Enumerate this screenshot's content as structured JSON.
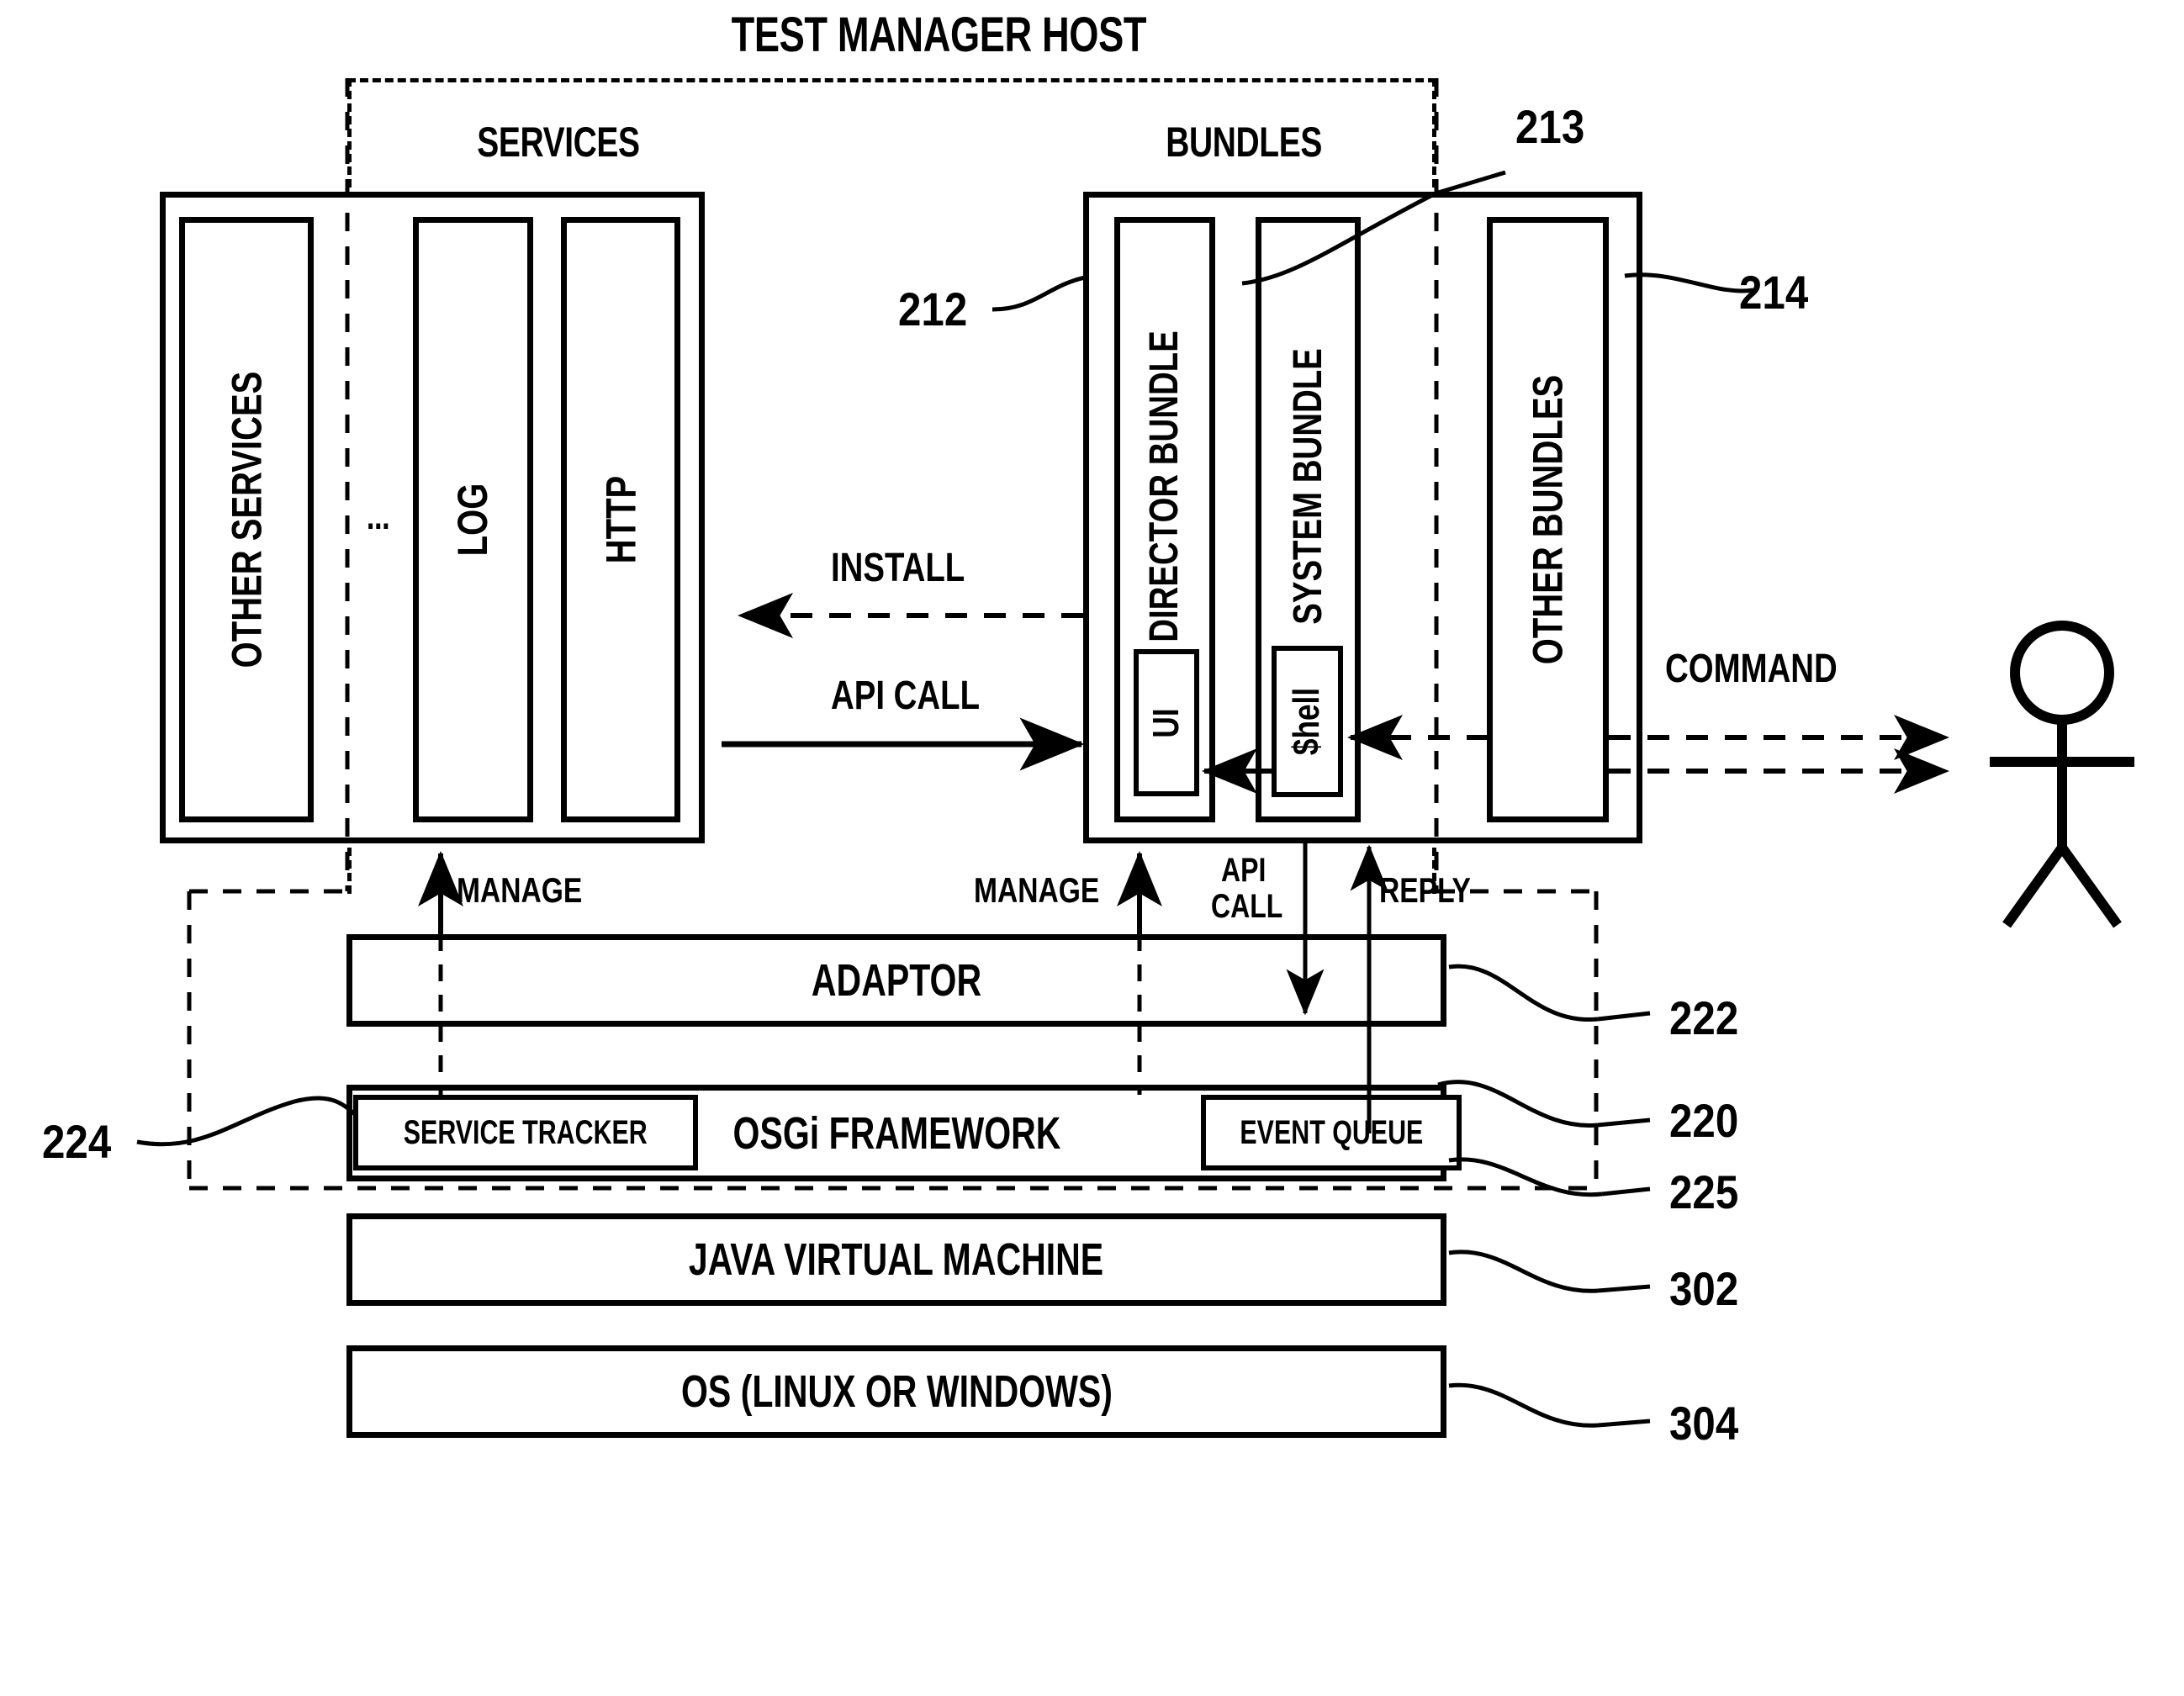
{
  "diagram": {
    "title": "TEST MANAGER HOST",
    "sections": {
      "services_label": "SERVICES",
      "bundles_label": "BUNDLES"
    },
    "services": {
      "other_services": "OTHER SERVICES",
      "ellipsis": "...",
      "log": "LOG",
      "http": "HTTP"
    },
    "bundles": {
      "director_bundle": "DIRECTOR BUNDLE",
      "system_bundle": "SYSTEM BUNDLE",
      "other_bundles": "OTHER BUNDLES",
      "ui": "UI",
      "shell": "$hell"
    },
    "arrows": {
      "install": "INSTALL",
      "api_call": "API CALL",
      "command": "COMMAND",
      "manage_left": "MANAGE",
      "manage_right": "MANAGE",
      "api_call_down_line1": "API",
      "api_call_down_line2": "CALL",
      "reply": "REPLY"
    },
    "layers": {
      "adaptor": "ADAPTOR",
      "service_tracker": "SERVICE TRACKER",
      "osgi_framework": "OSGi FRAMEWORK",
      "event_queue": "EVENT QUEUE",
      "jvm": "JAVA VIRTUAL MACHINE",
      "os": "OS (LINUX OR WINDOWS)"
    },
    "refs": {
      "r212": "212",
      "r213": "213",
      "r214": "214",
      "r220": "220",
      "r222": "222",
      "r224": "224",
      "r225": "225",
      "r302": "302",
      "r304": "304"
    },
    "actor": {
      "name": "user-actor"
    },
    "colors": {
      "ink": "#000000",
      "paper": "#ffffff"
    }
  }
}
